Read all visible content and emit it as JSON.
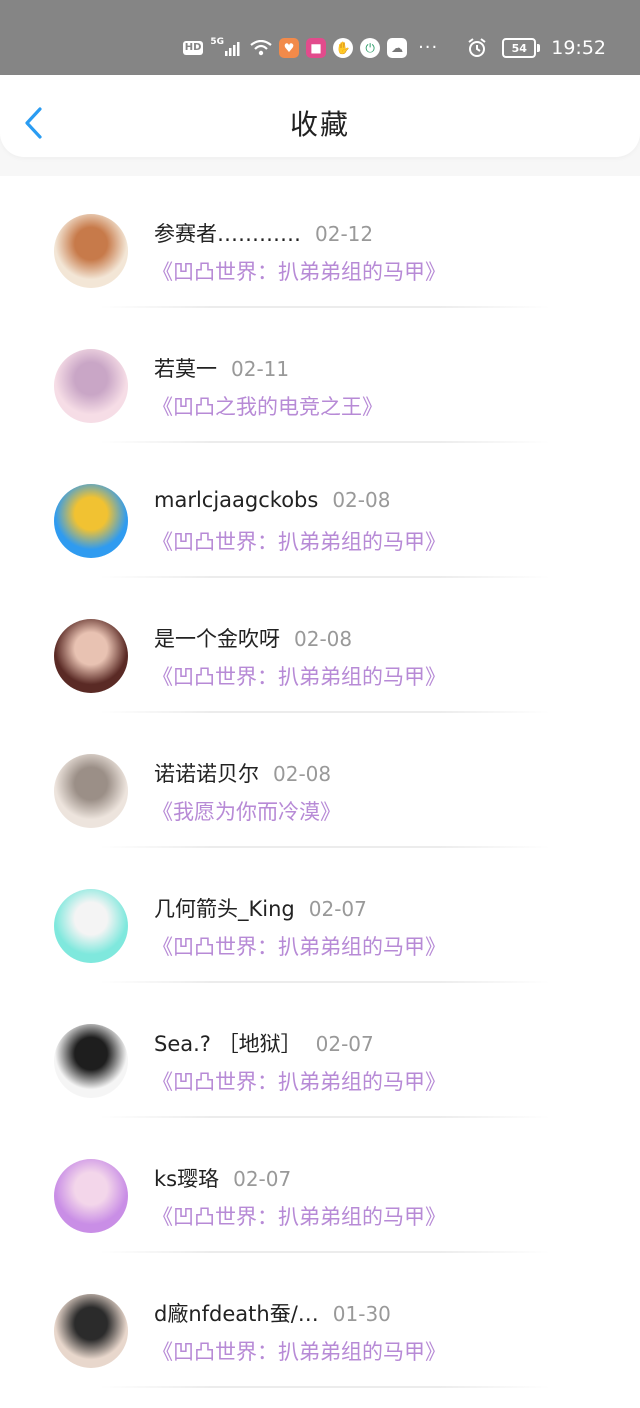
{
  "status_bar": {
    "hd": "HD",
    "network": "5G",
    "battery": "54",
    "time": "19:52",
    "icons": [
      "signal-icon",
      "wifi-icon",
      "health-app-icon",
      "app-icon",
      "hand-icon",
      "power-app-icon",
      "cloud-app-icon",
      "more-dots-icon",
      "alarm-icon"
    ]
  },
  "header": {
    "title": "收藏"
  },
  "items": [
    {
      "name": "参赛者…………",
      "date": "02-12",
      "book": "《凹凸世界：扒弟弟组的马甲》",
      "avatar_colors": [
        "#f3e6d6",
        "#c77a4a"
      ]
    },
    {
      "name": "若莫一",
      "date": "02-11",
      "book": "《凹凸之我的电竞之王》",
      "avatar_colors": [
        "#f6dde6",
        "#c9a6c6"
      ]
    },
    {
      "name": "marlcjaagckobs",
      "date": "02-08",
      "book": "《凹凸世界：扒弟弟组的马甲》",
      "avatar_colors": [
        "#2f9bf0",
        "#f1c232"
      ]
    },
    {
      "name": "是一个金吹呀",
      "date": "02-08",
      "book": "《凹凸世界：扒弟弟组的马甲》",
      "avatar_colors": [
        "#5a2a25",
        "#e8c2b2"
      ]
    },
    {
      "name": "诺诺诺贝尔",
      "date": "02-08",
      "book": "《我愿为你而冷漠》",
      "avatar_colors": [
        "#ede4dd",
        "#9b8f87"
      ]
    },
    {
      "name": "几何箭头_King",
      "date": "02-07",
      "book": "《凹凸世界：扒弟弟组的马甲》",
      "avatar_colors": [
        "#7fe8dd",
        "#f4f4f4"
      ]
    },
    {
      "name": "Sea.? ［地狱］",
      "date": "02-07",
      "book": "《凹凸世界：扒弟弟组的马甲》",
      "avatar_colors": [
        "#f5f5f5",
        "#1e1e1e"
      ]
    },
    {
      "name": "ks璎珞",
      "date": "02-07",
      "book": "《凹凸世界：扒弟弟组的马甲》",
      "avatar_colors": [
        "#c98ee6",
        "#f3d6ea"
      ]
    },
    {
      "name": "d廠nfdeath蚕/…",
      "date": "01-30",
      "book": "《凹凸世界：扒弟弟组的马甲》",
      "avatar_colors": [
        "#e8d7cc",
        "#2b2b2b"
      ]
    }
  ]
}
